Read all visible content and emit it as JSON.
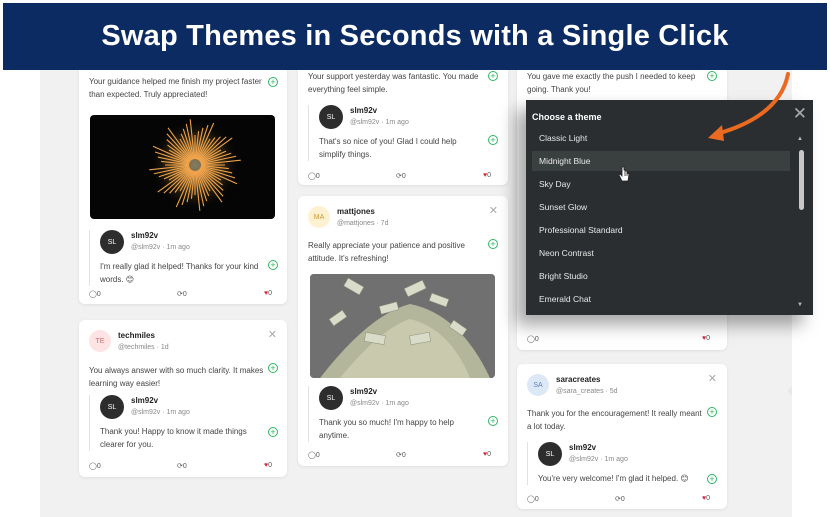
{
  "banner": {
    "title": "Swap Themes in Seconds with a Single Click"
  },
  "colors": {
    "banner_bg": "#0c2b62",
    "accent_green": "#2fb565",
    "heart_red": "#d62b3b",
    "dropdown_bg": "#2a2e31",
    "arrow_orange": "#ea6a22"
  },
  "col1": {
    "card1": {
      "text": "Your guidance helped me finish my project faster than expected. Truly appreciated!",
      "image": "fireworks",
      "reply": {
        "avatar": "SL",
        "name": "slm92v",
        "handle": "@slm92v · 1m ago",
        "text": "I'm really glad it helped! Thanks for your kind words. 😊"
      },
      "stats": {
        "comments": "0",
        "shares": "0",
        "likes": "0"
      }
    },
    "card2": {
      "avatar": "TE",
      "name": "techmiles",
      "handle": "@techmiles · 1d",
      "text": "You always answer with so much clarity. It makes learning way easier!",
      "reply": {
        "avatar": "SL",
        "name": "slm92v",
        "handle": "@slm92v · 1m ago",
        "text": "Thank you! Happy to know it made things clearer for you."
      },
      "stats": {
        "comments": "0",
        "shares": "0",
        "likes": "0"
      }
    }
  },
  "col2": {
    "card1": {
      "text": "Your support yesterday was fantastic. You made everything feel simple.",
      "reply": {
        "avatar": "SL",
        "name": "slm92v",
        "handle": "@slm92v · 1m ago",
        "text": "That's so nice of you! Glad I could help simplify things."
      },
      "stats": {
        "comments": "0",
        "shares": "0",
        "likes": "0"
      }
    },
    "card2": {
      "avatar": "MA",
      "name": "mattjones",
      "handle": "@mattjones · 7d",
      "text": "Really appreciate your patience and positive attitude. It's refreshing!",
      "image": "money-pile",
      "reply": {
        "avatar": "SL",
        "name": "slm92v",
        "handle": "@slm92v · 1m ago",
        "text": "Thank you so much! I'm happy to help anytime."
      },
      "stats": {
        "comments": "0",
        "shares": "0",
        "likes": "0"
      }
    }
  },
  "col3": {
    "card1": {
      "text": "You gave me exactly the push I needed to keep going. Thank you!",
      "stats": {
        "comments": "0",
        "likes": "0"
      }
    },
    "card2": {
      "avatar": "SA",
      "name": "saracreates",
      "handle": "@sara_creates · 5d",
      "text": "Thank you for the encouragement! It really meant a lot today.",
      "reply": {
        "avatar": "SL",
        "name": "slm92v",
        "handle": "@slm92v · 1m ago",
        "text": "You're very welcome! I'm glad it helped. 😊"
      },
      "stats": {
        "comments": "0",
        "shares": "0",
        "likes": "0"
      }
    }
  },
  "theme_menu": {
    "title": "Choose a theme",
    "items": [
      "Classic Light",
      "Midnight Blue",
      "Sky Day",
      "Sunset Glow",
      "Professional Standard",
      "Neon Contrast",
      "Bright Studio",
      "Emerald Chat"
    ],
    "highlighted": "Midnight Blue"
  }
}
